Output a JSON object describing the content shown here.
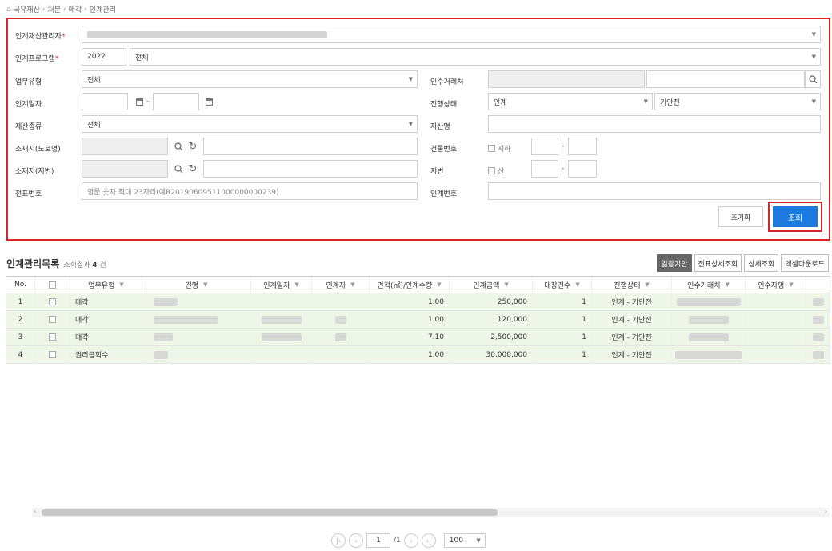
{
  "breadcrumb": [
    "국유재산",
    "처분",
    "매각",
    "인계관리"
  ],
  "form": {
    "asset_manager_label": "인계재산관리자",
    "program_label": "인계프로그램",
    "program_year": "2022",
    "program_value": "전체",
    "work_type_label": "업무유형",
    "work_type_value": "전체",
    "receiver_label": "인수거래처",
    "date_label": "인계일자",
    "status_label": "진행상태",
    "status_value1": "인계",
    "status_value2": "기안전",
    "asset_type_label": "재산종류",
    "asset_type_value": "전체",
    "asset_name_label": "자산명",
    "address_road_label": "소재지(도로명)",
    "building_no_label": "건물번호",
    "basement_label": "지하",
    "address_lot_label": "소재지(지번)",
    "lot_no_label": "지번",
    "mountain_label": "산",
    "slip_no_label": "전표번호",
    "slip_no_placeholder": "영문 숫자 최대 23자리(예R20190609511000000000239)",
    "handover_no_label": "인계번호",
    "reset_button": "초기화",
    "search_button": "조회"
  },
  "list": {
    "title": "인계관리목록",
    "result_label": "조회결과",
    "count": "4",
    "count_unit": "건",
    "buttons": [
      "일괄기안",
      "전표상세조회",
      "상세조회",
      "엑셀다운로드"
    ]
  },
  "grid": {
    "headers": [
      "No.",
      "",
      "업무유형",
      "건명",
      "인계일자",
      "인계자",
      "면적(㎡)/인계수량",
      "인계금액",
      "대장건수",
      "진행상태",
      "인수거래처",
      "인수자명"
    ],
    "rows": [
      {
        "no": "1",
        "type": "매각",
        "qty": "1.00",
        "amount": "250,000",
        "ledger": "1",
        "status": "인계 - 기안전"
      },
      {
        "no": "2",
        "type": "매각",
        "qty": "1.00",
        "amount": "120,000",
        "ledger": "1",
        "status": "인계 - 기안전"
      },
      {
        "no": "3",
        "type": "매각",
        "qty": "7.10",
        "amount": "2,500,000",
        "ledger": "1",
        "status": "인계 - 기안전"
      },
      {
        "no": "4",
        "type": "권리금회수",
        "qty": "1.00",
        "amount": "30,000,000",
        "ledger": "1",
        "status": "인계 - 기안전"
      }
    ]
  },
  "pager": {
    "current": "1",
    "total": "/1",
    "page_size": "100"
  }
}
